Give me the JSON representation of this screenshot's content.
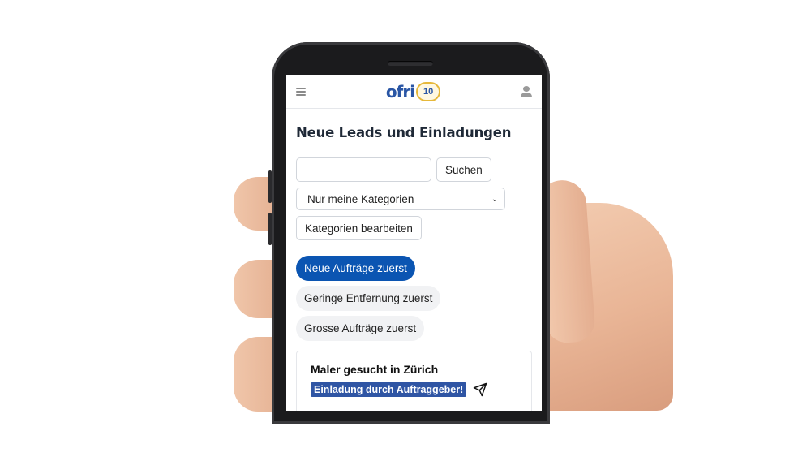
{
  "header": {
    "logo_text": "ofri",
    "logo_badge": "10"
  },
  "page": {
    "title": "Neue Leads und Einladungen"
  },
  "search": {
    "placeholder": "",
    "value": "",
    "button_label": "Suchen"
  },
  "filter": {
    "selected": "Nur meine Kategorien"
  },
  "edit_categories_label": "Kategorien bearbeiten",
  "sort_options": [
    {
      "label": "Neue Aufträge zuerst",
      "active": true
    },
    {
      "label": "Geringe Entfernung zuerst",
      "active": false
    },
    {
      "label": "Grosse Aufträge zuerst",
      "active": false
    }
  ],
  "lead_card": {
    "title": "Maler gesucht in Zürich",
    "badge": "Einladung durch Auftraggeber!"
  },
  "colors": {
    "primary": "#0b55b2",
    "badge": "#2f55a4",
    "logo": "#2a56a5",
    "logo_gold": "#e6b83a"
  },
  "icons": {
    "menu": "hamburger-icon",
    "user": "user-icon",
    "chevron": "chevron-down-icon",
    "send": "paper-plane-icon"
  }
}
